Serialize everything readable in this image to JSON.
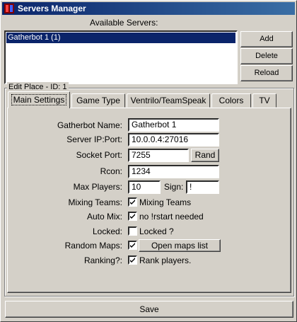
{
  "window": {
    "title": "Servers Manager"
  },
  "servers": {
    "heading": "Available Servers:",
    "items": [
      "Gatherbot 1 (1)"
    ],
    "add_label": "Add",
    "delete_label": "Delete",
    "reload_label": "Reload"
  },
  "edit_place": {
    "title": "Edit Place - ID: 1",
    "tabs": [
      "Main Settings",
      "Game Type",
      "Ventrilo/TeamSpeak",
      "Colors",
      "TV"
    ],
    "fields": {
      "name_label": "Gatherbot Name:",
      "name_value": "Gatherbot 1",
      "ip_label": "Server IP:Port:",
      "ip_value": "10.0.0.4:27016",
      "socket_label": "Socket Port:",
      "socket_value": "7255",
      "rand_label": "Rand",
      "rcon_label": "Rcon:",
      "rcon_value": "1234",
      "max_players_label": "Max Players:",
      "max_players_value": "10",
      "sign_label": "Sign:",
      "sign_value": "!",
      "mixing_label": "Mixing Teams:",
      "mixing_check_label": "Mixing Teams",
      "automix_label": "Auto Mix:",
      "automix_check_label": "no !rstart needed",
      "locked_label": "Locked:",
      "locked_check_label": "Locked ?",
      "random_maps_label": "Random Maps:",
      "open_maps_label": "Open maps list",
      "ranking_label": "Ranking?:",
      "ranking_check_label": "Rank players."
    }
  },
  "save_label": "Save"
}
